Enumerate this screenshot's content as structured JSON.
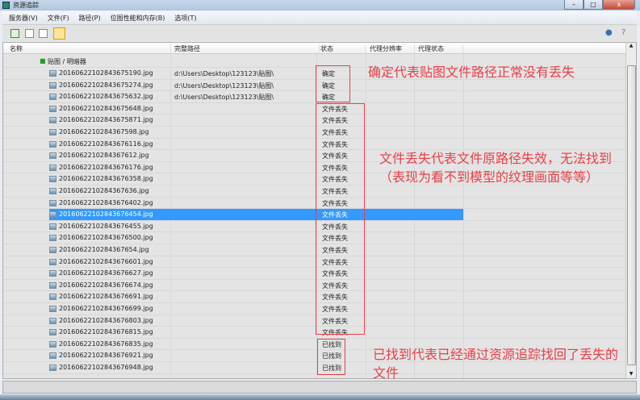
{
  "window": {
    "title": "资源追踪"
  },
  "menu": [
    "服务器(V)",
    "文件(F)",
    "路径(P)",
    "位图性能和内存(B)",
    "选项(T)"
  ],
  "toolbar": {
    "icons": [
      "refresh-icon",
      "list-icon",
      "thumbnail-icon",
      "table-view-icon"
    ],
    "active": "table-view-icon",
    "right_icons": [
      "help-bubble-icon",
      "question-icon"
    ]
  },
  "columns": [
    "名称",
    "完整路径",
    "状态",
    "代理分辨率",
    "代理状态"
  ],
  "group": {
    "label": "贴图 / 明暗器"
  },
  "rows": [
    {
      "name": "20160622102843675190.jpg",
      "path": "d:\\Users\\Desktop\\123123\\贴图\\",
      "status": "确定"
    },
    {
      "name": "20160622102843675274.jpg",
      "path": "d:\\Users\\Desktop\\123123\\贴图\\",
      "status": "确定"
    },
    {
      "name": "20160622102843675632.jpg",
      "path": "d:\\Users\\Desktop\\123123\\贴图\\",
      "status": "确定"
    },
    {
      "name": "20160622102843675648.jpg",
      "path": "",
      "status": "文件丢失"
    },
    {
      "name": "20160622102843675871.jpg",
      "path": "",
      "status": "文件丢失"
    },
    {
      "name": "2016062210284367598.jpg",
      "path": "",
      "status": "文件丢失"
    },
    {
      "name": "20160622102843676116.jpg",
      "path": "",
      "status": "文件丢失"
    },
    {
      "name": "2016062210284367612.jpg",
      "path": "",
      "status": "文件丢失"
    },
    {
      "name": "20160622102843676176.jpg",
      "path": "",
      "status": "文件丢失"
    },
    {
      "name": "20160622102843676358.jpg",
      "path": "",
      "status": "文件丢失"
    },
    {
      "name": "2016062210284367636.jpg",
      "path": "",
      "status": "文件丢失"
    },
    {
      "name": "20160622102843676402.jpg",
      "path": "",
      "status": "文件丢失"
    },
    {
      "name": "20160622102843676454.jpg",
      "path": "",
      "status": "文件丢失",
      "selected": true
    },
    {
      "name": "20160622102843676455.jpg",
      "path": "",
      "status": "文件丢失"
    },
    {
      "name": "20160622102843676500.jpg",
      "path": "",
      "status": "文件丢失"
    },
    {
      "name": "2016062210284367654.jpg",
      "path": "",
      "status": "文件丢失"
    },
    {
      "name": "20160622102843676601.jpg",
      "path": "",
      "status": "文件丢失"
    },
    {
      "name": "20160622102843676627.jpg",
      "path": "",
      "status": "文件丢失"
    },
    {
      "name": "20160622102843676674.jpg",
      "path": "",
      "status": "文件丢失"
    },
    {
      "name": "20160622102843676691.jpg",
      "path": "",
      "status": "文件丢失"
    },
    {
      "name": "20160622102843676699.jpg",
      "path": "",
      "status": "文件丢失"
    },
    {
      "name": "20160622102843676803.jpg",
      "path": "",
      "status": "文件丢失"
    },
    {
      "name": "20160622102843676815.jpg",
      "path": "",
      "status": "文件丢失"
    },
    {
      "name": "20160622102843676835.jpg",
      "path": "",
      "status": "已找到"
    },
    {
      "name": "20160622102843676921.jpg",
      "path": "",
      "status": "已找到"
    },
    {
      "name": "20160622102843676948.jpg",
      "path": "",
      "status": "已找到"
    }
  ],
  "annotations": {
    "ok": "确定代表贴图文件路径正常没有丢失",
    "missing": "文件丢失代表文件原路径失效，无法找到（表现为看不到模型的纹理画面等等）",
    "found": "已找到代表已经通过资源追踪找回了丢失的文件"
  },
  "colors": {
    "annotation": "#e8404a",
    "selection": "#3399ff"
  }
}
